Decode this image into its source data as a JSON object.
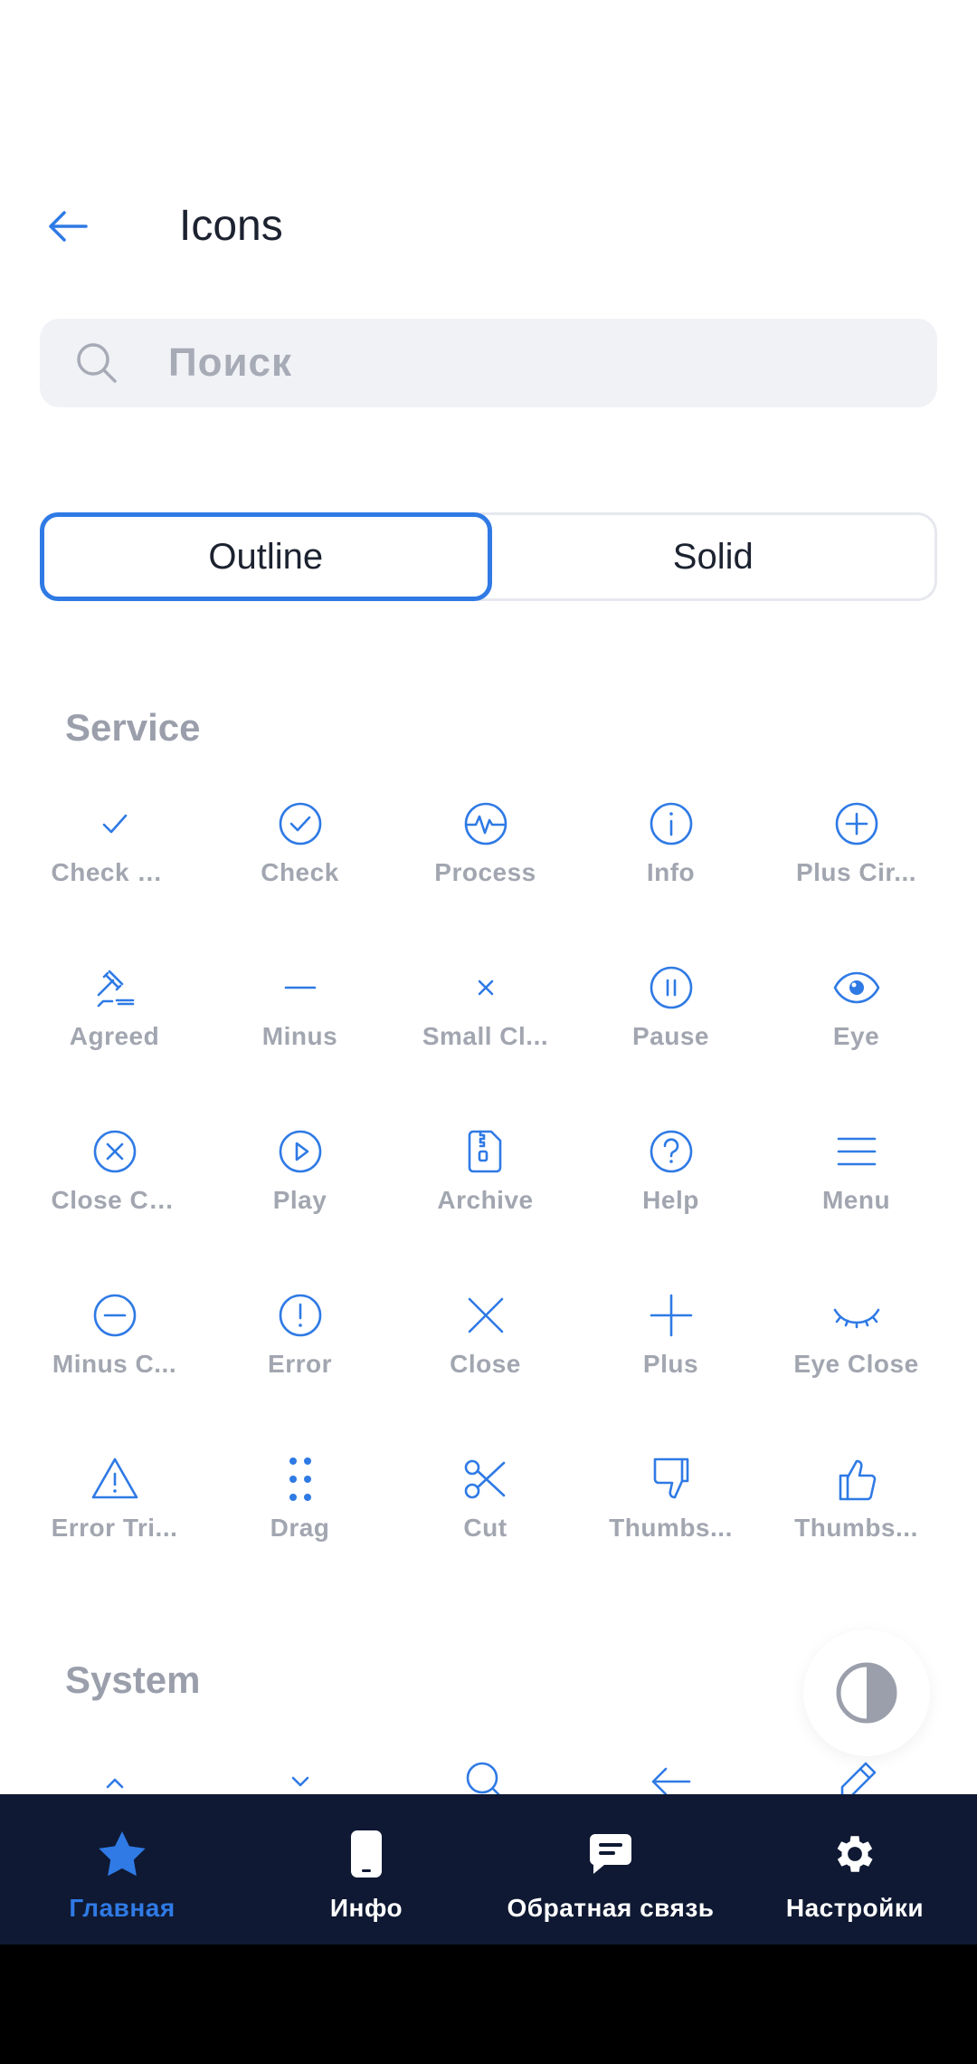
{
  "header": {
    "title": "Icons",
    "back_icon": "arrow-left-icon"
  },
  "search": {
    "placeholder": "Поиск",
    "value": ""
  },
  "segmented": {
    "options": [
      "Outline",
      "Solid"
    ],
    "selected": "Outline"
  },
  "sections": [
    {
      "title": "Service",
      "icons": [
        {
          "label": "Check C...",
          "icon": "check-icon"
        },
        {
          "label": "Check",
          "icon": "check-circle-icon"
        },
        {
          "label": "Process",
          "icon": "process-icon"
        },
        {
          "label": "Info",
          "icon": "info-icon"
        },
        {
          "label": "Plus Cir...",
          "icon": "plus-circle-icon"
        },
        {
          "label": "Agreed",
          "icon": "gavel-icon"
        },
        {
          "label": "Minus",
          "icon": "minus-icon"
        },
        {
          "label": "Small Cl...",
          "icon": "small-close-icon"
        },
        {
          "label": "Pause",
          "icon": "pause-icon"
        },
        {
          "label": "Eye",
          "icon": "eye-icon"
        },
        {
          "label": "Close Ci...",
          "icon": "close-circle-icon"
        },
        {
          "label": "Play",
          "icon": "play-icon"
        },
        {
          "label": "Archive",
          "icon": "archive-icon"
        },
        {
          "label": "Help",
          "icon": "help-icon"
        },
        {
          "label": "Menu",
          "icon": "menu-icon"
        },
        {
          "label": "Minus C...",
          "icon": "minus-circle-icon"
        },
        {
          "label": "Error",
          "icon": "error-icon"
        },
        {
          "label": "Close",
          "icon": "close-icon"
        },
        {
          "label": "Plus",
          "icon": "plus-icon"
        },
        {
          "label": "Eye Close",
          "icon": "eye-close-icon"
        },
        {
          "label": "Error Tri...",
          "icon": "error-triangle-icon"
        },
        {
          "label": "Drag",
          "icon": "drag-icon"
        },
        {
          "label": "Cut",
          "icon": "scissors-icon"
        },
        {
          "label": "Thumbs...",
          "icon": "thumbs-down-icon"
        },
        {
          "label": "Thumbs...",
          "icon": "thumbs-up-icon"
        }
      ]
    },
    {
      "title": "System",
      "icons": [
        {
          "icon": "chevron-up-icon"
        },
        {
          "icon": "chevron-down-icon"
        },
        {
          "icon": "search-icon"
        },
        {
          "icon": "arrow-left-icon"
        },
        {
          "icon": "pencil-icon"
        }
      ]
    }
  ],
  "theme_toggle": {
    "icon": "contrast-icon"
  },
  "bottom_nav": [
    {
      "label": "Главная",
      "icon": "star-icon",
      "active": true
    },
    {
      "label": "Инфо",
      "icon": "phone-icon",
      "active": false
    },
    {
      "label": "Обратная связь",
      "icon": "chat-icon",
      "active": false
    },
    {
      "label": "Настройки",
      "icon": "settings-icon",
      "active": false
    }
  ],
  "colors": {
    "accent": "#2f7ae5",
    "label": "#a2a6b0",
    "nav_bg": "#0f1933",
    "section_title": "#9a9fab"
  }
}
